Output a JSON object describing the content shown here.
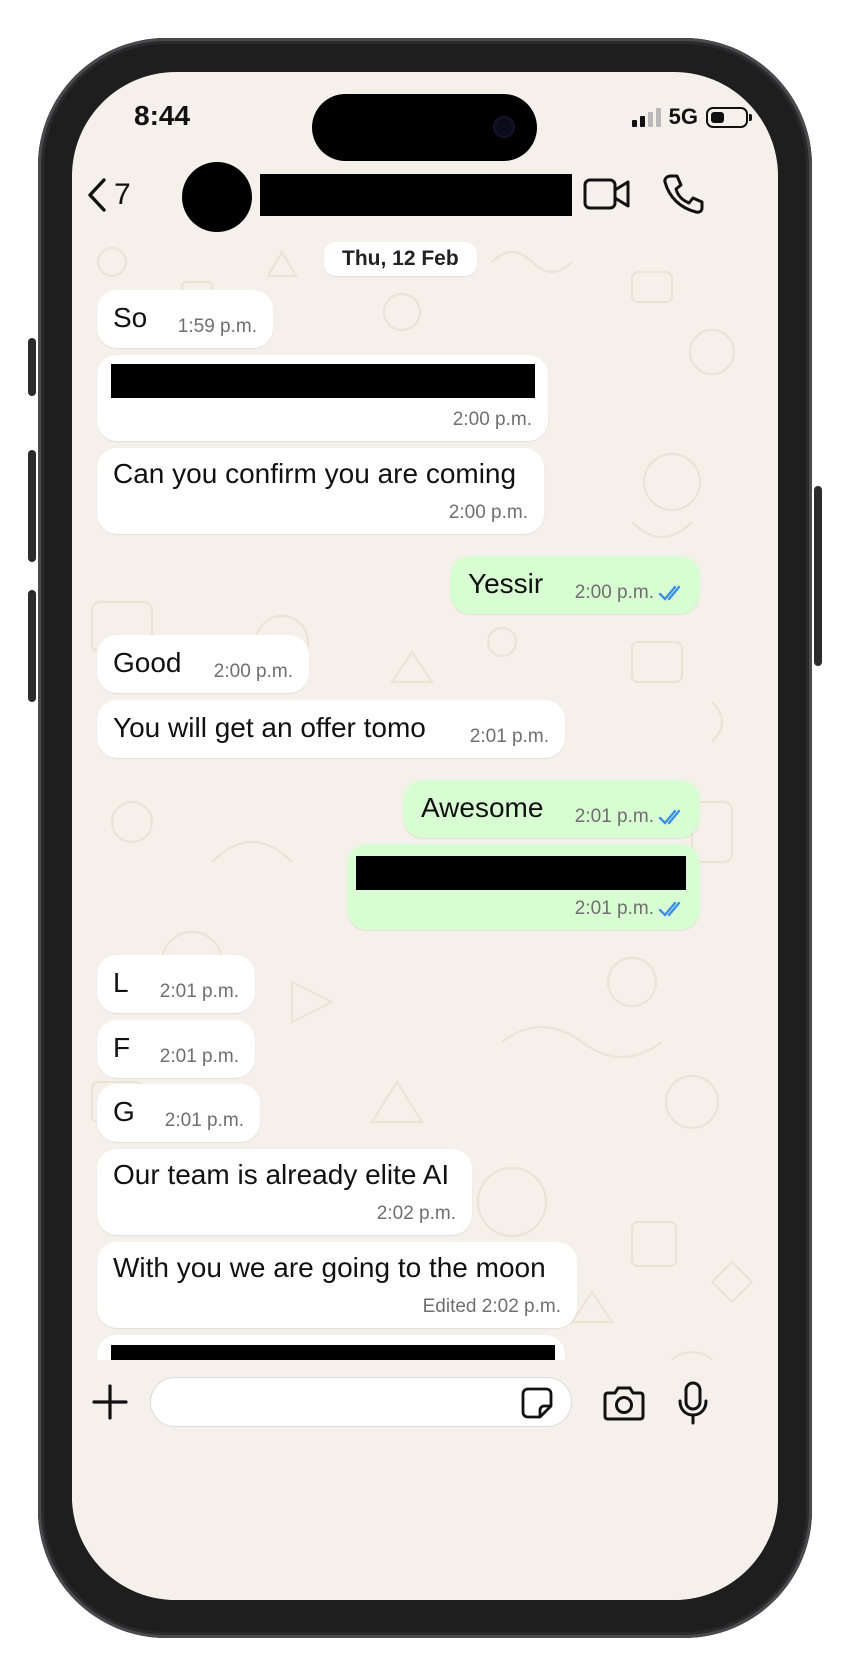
{
  "status_bar": {
    "time": "8:44",
    "network": "5G"
  },
  "header": {
    "back_count": "7"
  },
  "chat": {
    "date_divider": "Thu, 12 Feb",
    "messages": [
      {
        "direction": "in",
        "text": "So",
        "time": "1:59 p.m."
      },
      {
        "direction": "in",
        "text": "",
        "time": "2:00 p.m."
      },
      {
        "direction": "in",
        "text": "Can you confirm you are coming",
        "time": "2:00 p.m."
      },
      {
        "direction": "out",
        "text": "Yessir",
        "time": "2:00 p.m."
      },
      {
        "direction": "in",
        "text": "Good",
        "time": "2:00 p.m."
      },
      {
        "direction": "in",
        "text": "You will get an offer tomo",
        "time": "2:01 p.m."
      },
      {
        "direction": "out",
        "text": "Awesome",
        "time": "2:01 p.m."
      },
      {
        "direction": "out",
        "text": "",
        "time": "2:01 p.m."
      },
      {
        "direction": "in",
        "text": "L",
        "time": "2:01 p.m."
      },
      {
        "direction": "in",
        "text": "F",
        "time": "2:01 p.m."
      },
      {
        "direction": "in",
        "text": "G",
        "time": "2:01 p.m."
      },
      {
        "direction": "in",
        "text": "Our team is already elite AI",
        "time": "2:02 p.m."
      },
      {
        "direction": "in",
        "text": "With you we are going to the moon",
        "time": "Edited 2:02 p.m."
      }
    ]
  },
  "colors": {
    "incoming": "#ffffff",
    "outgoing": "#d8fdd2",
    "read_ticks": "#3b8fe8",
    "chat_bg": "#f5f1ea"
  },
  "icons": [
    "back-chevron-icon",
    "video-call-icon",
    "phone-call-icon",
    "chevron-down-icon",
    "plus-icon",
    "sticker-icon",
    "camera-icon",
    "microphone-icon",
    "double-tick-icon"
  ]
}
